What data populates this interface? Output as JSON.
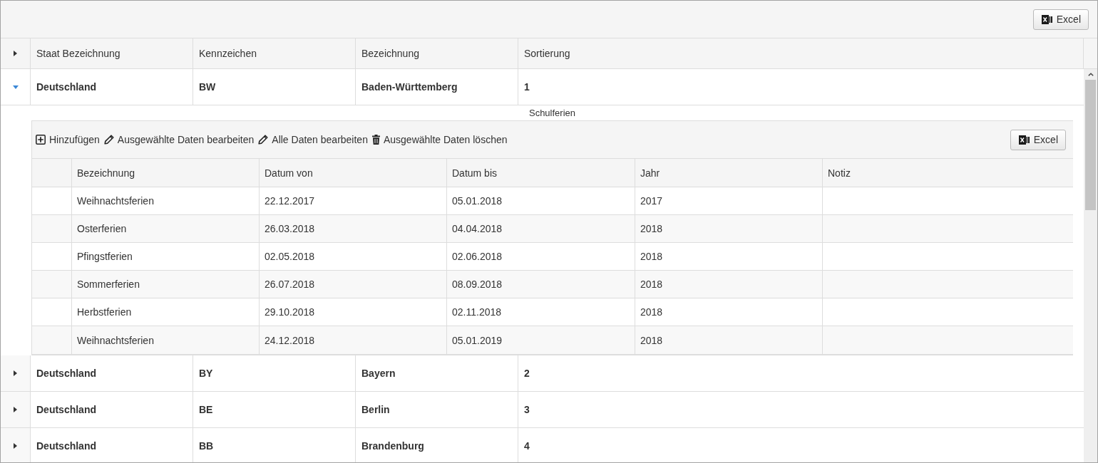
{
  "toolbar": {
    "export_button": "Excel"
  },
  "grid": {
    "columns": [
      "Staat Bezeichnung",
      "Kennzeichen",
      "Bezeichnung",
      "Sortierung"
    ],
    "rows": [
      {
        "expanded": true,
        "cells": [
          "Deutschland",
          "BW",
          "Baden-Württemberg",
          "1"
        ],
        "detail": {
          "title": "Schulferien",
          "actions": [
            {
              "kind": "add",
              "label": "Hinzufügen"
            },
            {
              "kind": "edit",
              "label": "Ausgewählte Daten bearbeiten"
            },
            {
              "kind": "edit",
              "label": "Alle Daten bearbeiten"
            },
            {
              "kind": "delete",
              "label": "Ausgewählte Daten löschen"
            }
          ],
          "export_button": "Excel",
          "columns": [
            "Bezeichnung",
            "Datum von",
            "Datum bis",
            "Jahr",
            "Notiz"
          ],
          "rows": [
            [
              "Weihnachtsferien",
              "22.12.2017",
              "05.01.2018",
              "2017"
            ],
            [
              "Osterferien",
              "26.03.2018",
              "04.04.2018",
              "2018"
            ],
            [
              "Pfingstferien",
              "02.05.2018",
              "02.06.2018",
              "2018"
            ],
            [
              "Sommerferien",
              "26.07.2018",
              "08.09.2018",
              "2018"
            ],
            [
              "Herbstferien",
              "29.10.2018",
              "02.11.2018",
              "2018"
            ],
            [
              "Weihnachtsferien",
              "24.12.2018",
              "05.01.2019",
              "2018"
            ]
          ]
        }
      },
      {
        "expanded": false,
        "cells": [
          "Deutschland",
          "BY",
          "Bayern",
          "2"
        ]
      },
      {
        "expanded": false,
        "cells": [
          "Deutschland",
          "BE",
          "Berlin",
          "3"
        ]
      },
      {
        "expanded": false,
        "cells": [
          "Deutschland",
          "BB",
          "Brandenburg",
          "4"
        ]
      }
    ]
  }
}
